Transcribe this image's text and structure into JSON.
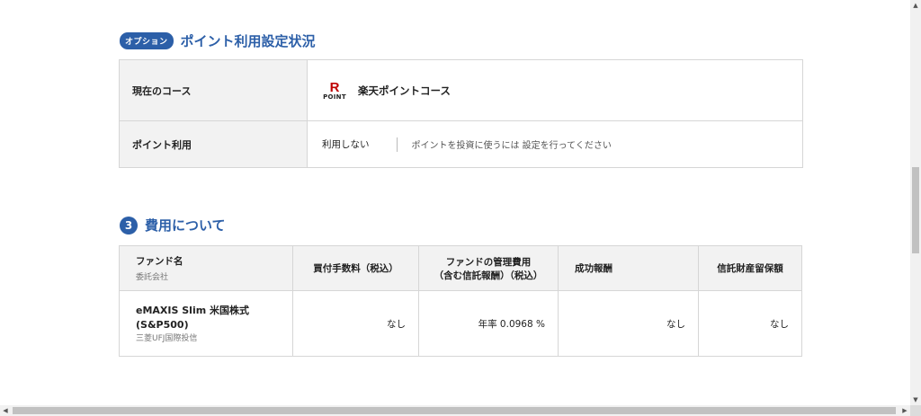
{
  "points_section": {
    "badge": "オプション",
    "title": "ポイント利用設定状況",
    "course_label": "現在のコース",
    "logo_r": "R",
    "logo_point": "POINT",
    "course_value": "楽天ポイントコース",
    "use_label": "ポイント利用",
    "use_value": "利用しない",
    "use_note": "ポイントを投資に使うには 設定を行ってください"
  },
  "fee_section": {
    "number": "3",
    "title": "費用について",
    "headers": {
      "fund": "ファンド名",
      "fund_sub": "委託会社",
      "buy_fee": "買付手数料（税込）",
      "mgmt_fee_line1": "ファンドの管理費用",
      "mgmt_fee_line2": "（含む信託報酬）（税込）",
      "success_fee": "成功報酬",
      "trust_fee": "信託財産留保額"
    },
    "row": {
      "fund_line1": "eMAXIS Slim 米国株式",
      "fund_line2": "(S&P500)",
      "company": "三菱UFJ国際投信",
      "buy_fee": "なし",
      "mgmt_fee": "年率 0.0968 %",
      "success_fee": "なし",
      "trust_fee": "なし"
    }
  },
  "icons": {
    "scroll_up": "scroll-up-arrow-icon",
    "scroll_down": "scroll-down-arrow-icon",
    "scroll_left": "scroll-left-arrow-icon",
    "scroll_right": "scroll-right-arrow-icon"
  },
  "colors": {
    "accent": "#2c5fa8",
    "rakuten_red": "#bf0000",
    "header_bg": "#f2f2f2"
  }
}
